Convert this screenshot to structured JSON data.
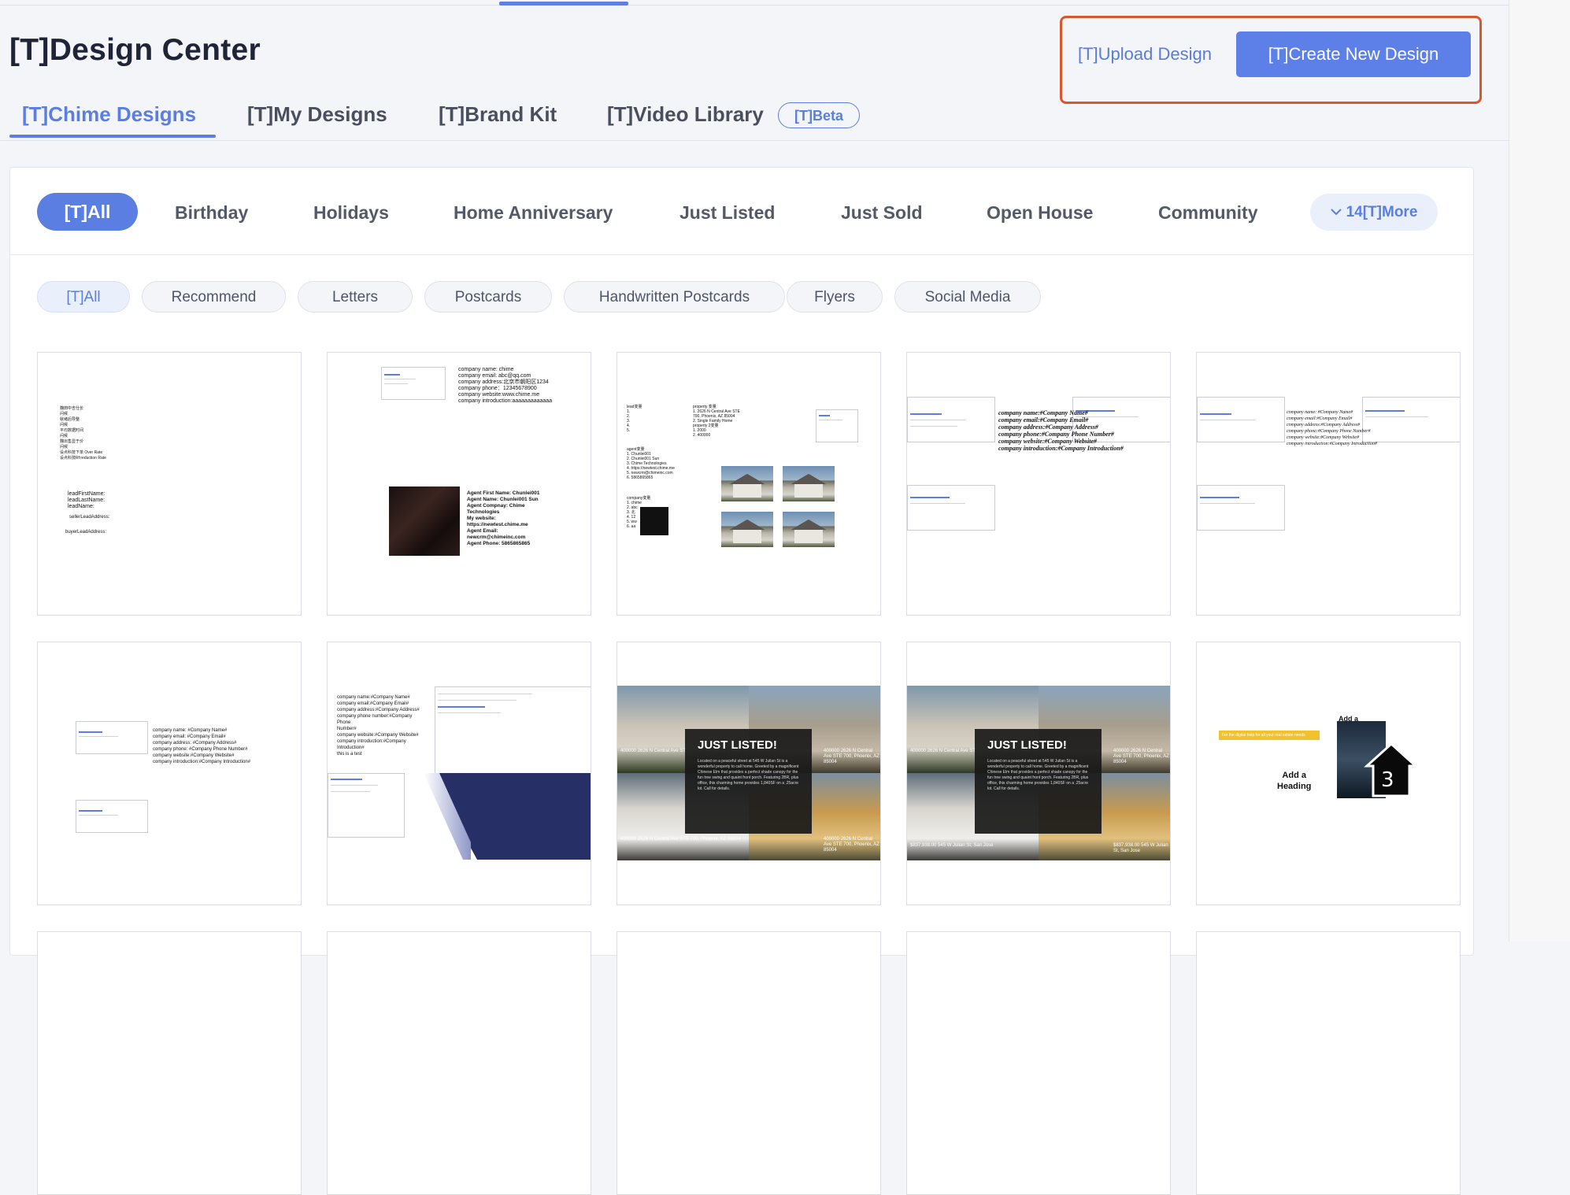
{
  "header": {
    "title": "[T]Design Center",
    "upload_label": "[T]Upload Design",
    "create_label": "[T]Create New Design"
  },
  "tabs": [
    {
      "label": "[T]Chime Designs",
      "active": true
    },
    {
      "label": "[T]My Designs"
    },
    {
      "label": "[T]Brand Kit"
    },
    {
      "label": "[T]Video Library"
    }
  ],
  "beta_badge": "[T]Beta",
  "categories": {
    "all": "[T]All",
    "items": [
      "Birthday",
      "Holidays",
      "Home Anniversary",
      "Just Listed",
      "Just Sold",
      "Open House",
      "Community"
    ],
    "more_label": "14[T]More",
    "more_icon": "chevron-down-icon"
  },
  "filters": [
    "[T]All",
    "Recommend",
    "Letters",
    "Postcards",
    "Handwritten Postcards",
    "Flyers",
    "Social Media"
  ],
  "cards": {
    "c1": {
      "lines": "魏田中吉仕长\n问候\n就绪后导整\n问候\n平均数据时间\n问候\n魏出售显于价\n问候\n设点科技下单 Over Rate\n设点科技Rf:reduction Rate",
      "lead": "leadFirstName:\nleadLastName:\nleadName:",
      "addr": "sellerLeadAddress:",
      "buyer": "buyerLeadAddress:"
    },
    "c2": {
      "company": "company name: chime\ncompany email: abc@qq.com\ncompany address:北京市朝阳区1234\ncompany phone：12345678900\ncompany website:www.chime.me\ncompany introduction:aaaaaaaaaaaaa",
      "agent": "Agent First Name: Chunlei001\nAgent Name: Chunlei001 Sun\nAgent Compnay: Chime\nTechnologies\nMy website:\nhttps://newtest.chime.me\nAgent Email:\nnewcrm@chimeinc.com\nAgent Phone: 5865865865"
    },
    "c3": {
      "lead": "lead变量\n1.\n2.\n3.\n4.\n5.",
      "property": "property 变量\n1. 2626 N Central Ave STE\n700, Phoenix, AZ 85004\n2. Single Family Home\nproperty 2变量\n1. 2000\n2. 400000",
      "agent": "agent变量\n1. Chunlei001\n2. Chunlei001 Sun\n3. Chime Technologies\n4. https://newtest.chime.me\n5. newcrm@chimeinc.com\n6. 5865865865",
      "company": "company变量\n1. chime\n2. abc\n3. 北\n4. 12\n5. ww\n6. aa"
    },
    "c4": {
      "text": "company name:#Company Name#\ncompany email:#Company Email#\ncompany address:#Company Address#\ncompany phone:#Company Phone Number#\ncompany website:#Company Website#\ncompany introduction:#Company Introduction#"
    },
    "c5": {
      "text": "company name: #Company Name#\ncompany email:#Company Email#\ncompany address:#Company Address#\ncompany phone:#Company Phone Number#\ncompany website:#Company Website#\ncompany introduction:#Company Introduction#"
    },
    "c6": {
      "text": "company name: #Company Name#\ncompany email: #Company Email#\ncompany address: #Company Address#\ncompany phone: #Company Phone Number#\ncompany website:#Company Website#\ncompany introduction:#Company Introduction#"
    },
    "c7": {
      "text": "company name:#Company Name#\ncompany email:#Company Email#\ncompany address:#Company Address#\ncompany phone number:#Company\nPhone\nNumber#\ncompany website:#Company Website#\ncompany introduction:#Company\nIntroduction#\nthis is a test"
    },
    "c8": {
      "heading": "JUST LISTED!",
      "body": "Located on a peaceful street at 545 W Julian St is a wonderful property to call home. Greeted by a magnificent Chinese Elm that provides a perfect shade canopy for the fun tree swing and quaint front porch. Featuring 2BR, plus office, this charming home provides 1,840SF on a .25acre lot. Call for details.",
      "cap_tl": "400000\n2626 N Central Ave STE\n700, Phoenix, AZ 85004",
      "cap_tr": "400000\n2626 N Central Ave STE\n700, Phoenix, AZ 85004",
      "cap_bl": "400000\n2626 N Central Ave STE\n700, Phoenix, AZ 85004",
      "cap_br": "400000\n2626 N Central Ave STE\n700, Phoenix, AZ 85004"
    },
    "c9": {
      "heading": "JUST LISTED!",
      "body": "Located on a peaceful street at 545 W Julian St is a wonderful property to call home. Greeted by a magnificent Chinese Elm that provides a perfect shade canopy for the fun tree swing and quaint front porch. Featuring 2BR, plus office, this charming home provides 1,840SF on a .25acre lot. Call for details.",
      "cap_tl": "400000\n2626 N Central Ave STE\n700, Phoenix, AZ 85004",
      "cap_tr": "400000\n2626 N Central Ave STE\n700, Phoenix, AZ 85004",
      "cap_bl": "$837,938.00\n545 W Julian St, San Jose",
      "cap_br": "$837,938.00\n545 W Julian St, San Jose"
    },
    "c10": {
      "banner": "For the digital help for all your real estate needs",
      "heading": "Add a\nHeading",
      "add_small": "Add a",
      "number": "3"
    }
  },
  "colors": {
    "accent": "#5a7ee2",
    "highlight_border": "#d6582b",
    "banner_yellow": "#f2c12e"
  }
}
